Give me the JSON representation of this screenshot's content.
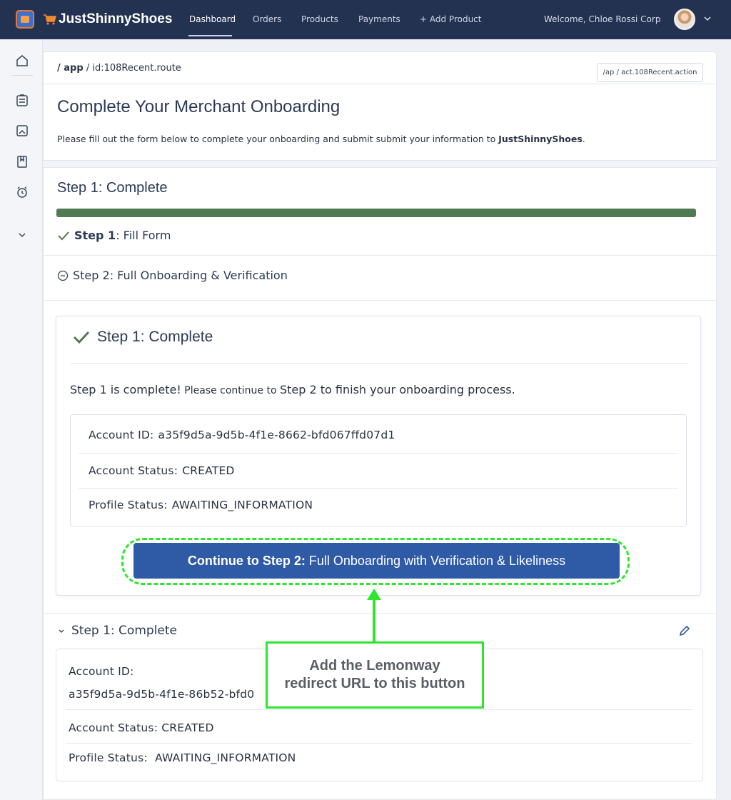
{
  "nav": {
    "brand": "JustShinnyShoes",
    "links": [
      "Dashboard",
      "Orders",
      "Products",
      "Payments",
      "+ Add Product"
    ],
    "welcome": "Welcome, Chloe Rossi Corp"
  },
  "sidebar": {
    "icons": [
      "home-icon",
      "clipboard-icon",
      "image-edit-icon",
      "bookmark-icon",
      "alarm-clock-icon",
      "chevron-down-icon"
    ]
  },
  "breadcrumb": {
    "root": "/ app",
    "sep": "/",
    "current": "id:108Recent.route",
    "chip_prefix": "/ap",
    "chip_sep": "/",
    "chip_value": "act.108Recent.action"
  },
  "header": {
    "title": "Complete Your Merchant Onboarding",
    "subtitle_pre": "Please fill out the form below to complete your onboarding and submit submit your information to ",
    "subtitle_brand": "JustShinnyShoes",
    "subtitle_post": "."
  },
  "steps": {
    "heading": "Step 1: Complete",
    "progress": 1.0,
    "step1_bold": "Step 1",
    "step1_rest": ": Fill Form",
    "step2": "Step 2:  Full Onboarding & Verification"
  },
  "card": {
    "title": "Step 1: Complete",
    "msg_a": "Step 1 is complete!",
    "msg_b": " Please continue to ",
    "msg_c": "Step 2 to finish your onboarding process.",
    "account_id_label": "Account ID:",
    "account_id": "a35f9d5a-9d5b-4f1e-8662-bfd067ffd07d1",
    "account_status_label": "Account Status:",
    "account_status": "CREATED",
    "profile_status_label": "Profile Status:",
    "profile_status": "AWAITING_INFORMATION",
    "cta_bold": "Continue to Step 2:",
    "cta_rest": "Full Onboarding with Verification & Likeliness"
  },
  "summary": {
    "heading": "Step 1: Complete",
    "account_id_label": "Account ID:",
    "account_id": "a35f9d5a-9d5b-4f1e-86b52-bfd0",
    "account_status_label": "Account Status:",
    "account_status": "CREATED",
    "profile_status_label": "Profile Status:",
    "profile_status": "AWAITING_INFORMATION"
  },
  "annotation": {
    "line1": "Add the Lemonway",
    "line2": "redirect URL to this button"
  },
  "colors": {
    "nav_bg": "#243252",
    "primary": "#2f5aa6",
    "progress": "#4f7a52",
    "annotation": "#2ee62e"
  }
}
